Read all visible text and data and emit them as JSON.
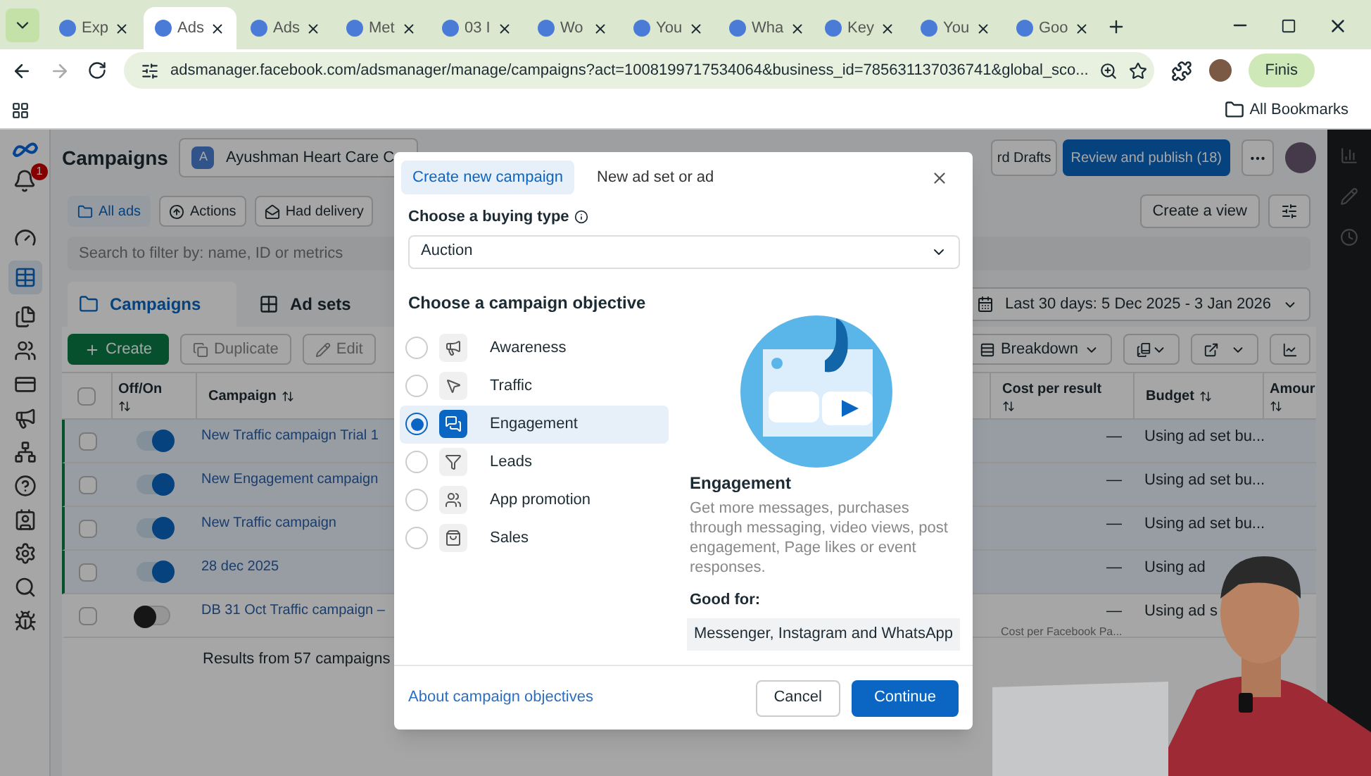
{
  "browser": {
    "tabs": [
      {
        "title": "Exp",
        "selected": false
      },
      {
        "title": "Ads",
        "selected": true
      },
      {
        "title": "Ads",
        "selected": false
      },
      {
        "title": "Met",
        "selected": false
      },
      {
        "title": "03 I",
        "selected": false
      },
      {
        "title": "Wo",
        "selected": false
      },
      {
        "title": "You",
        "selected": false
      },
      {
        "title": "Wha",
        "selected": false
      },
      {
        "title": "Key",
        "selected": false
      },
      {
        "title": "You",
        "selected": false
      },
      {
        "title": "Goo",
        "selected": false
      }
    ],
    "url": "adsmanager.facebook.com/adsmanager/manage/campaigns?act=1008199717534064&business_id=785631137036741&global_sco...",
    "profile_button": "Finis",
    "bookmarks": "All Bookmarks"
  },
  "header": {
    "title": "Campaigns",
    "account_initial": "A",
    "account_name": "Ayushman Heart Care C",
    "drafts": "rd Drafts",
    "publish": "Review and publish (18)",
    "notifications": "1"
  },
  "filters": [
    {
      "label": "All ads",
      "selected": true
    },
    {
      "label": "Actions",
      "selected": false
    },
    {
      "label": "Had delivery",
      "selected": false
    }
  ],
  "create_view": "Create a view",
  "search": {
    "placeholder": "Search to filter by: name, ID or metrics"
  },
  "level_tabs": [
    {
      "label": "Campaigns",
      "selected": true
    },
    {
      "label": "Ad sets",
      "selected": false
    }
  ],
  "date_range": "Last 30 days: 5 Dec 2025 - 3 Jan 2026",
  "toolbar": {
    "create": "Create",
    "duplicate": "Duplicate",
    "edit": "Edit",
    "breakdown": "Breakdown"
  },
  "table": {
    "columns": {
      "toggle": "Off/On",
      "campaign": "Campaign",
      "cost": "Cost per result",
      "budget": "Budget",
      "amount": "Amour"
    },
    "select_all_checked": false,
    "rows": [
      {
        "checked": false,
        "selected": true,
        "on": true,
        "name": "New Traffic campaign Trial 1",
        "cost": "—",
        "budget": "Using ad set bu..."
      },
      {
        "checked": false,
        "selected": true,
        "on": true,
        "name": "New Engagement campaign",
        "cost": "—",
        "budget": "Using ad set bu..."
      },
      {
        "checked": false,
        "selected": true,
        "on": true,
        "name": "New Traffic campaign",
        "cost": "—",
        "budget": "Using ad set bu..."
      },
      {
        "checked": false,
        "selected": true,
        "on": true,
        "name": "28 dec 2025",
        "cost": "—",
        "budget": "Using ad"
      },
      {
        "checked": false,
        "selected": false,
        "on": false,
        "name": "DB 31 Oct Traffic campaign –",
        "cost": "—",
        "budget": "Using ad s",
        "cost_note": "Cost per Facebook Pa..."
      }
    ],
    "footer": "Results from 57 campaigns"
  },
  "modal": {
    "tabs": [
      {
        "label": "Create new campaign",
        "selected": true
      },
      {
        "label": "New ad set or ad",
        "selected": false
      }
    ],
    "buying_label": "Choose a buying type",
    "buying_value": "Auction",
    "objective_label": "Choose a campaign objective",
    "objectives": [
      {
        "label": "Awareness",
        "selected": false
      },
      {
        "label": "Traffic",
        "selected": false
      },
      {
        "label": "Engagement",
        "selected": true
      },
      {
        "label": "Leads",
        "selected": false
      },
      {
        "label": "App promotion",
        "selected": false
      },
      {
        "label": "Sales",
        "selected": false
      }
    ],
    "detail_title": "Engagement",
    "detail_text": "Get more messages, purchases through messaging, video views, post engagement, Page likes or event responses.",
    "good_for_label": "Good for:",
    "good_for": "Messenger, Instagram and WhatsApp",
    "link": "About campaign objectives",
    "cancel": "Cancel",
    "continue": "Continue"
  }
}
